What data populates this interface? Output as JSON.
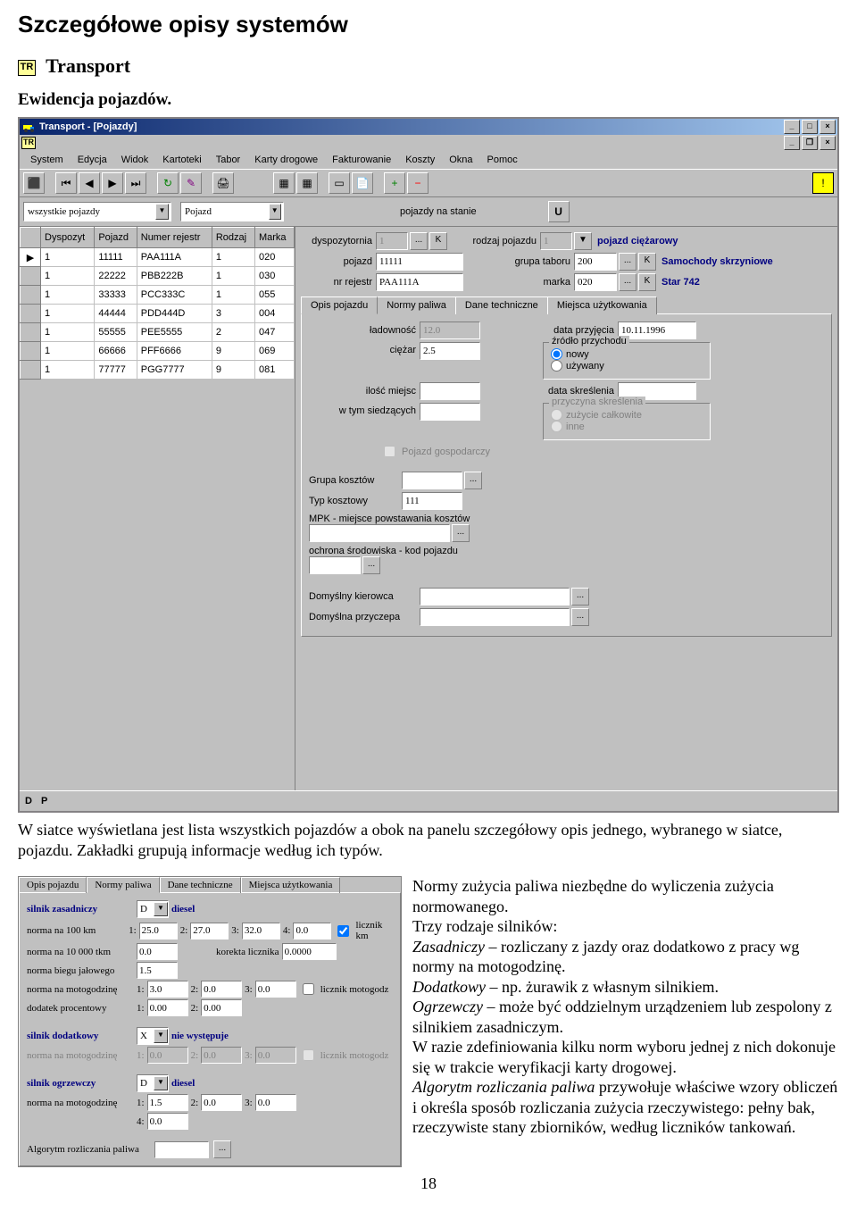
{
  "page": {
    "heading": "Szczegółowe opisy systemów",
    "tr_badge": "TR",
    "subheading": "Transport",
    "section": "Ewidencja pojazdów.",
    "page_number": "18"
  },
  "app": {
    "title": "Transport - [Pojazdy]",
    "menu": [
      "System",
      "Edycja",
      "Widok",
      "Kartoteki",
      "Tabor",
      "Karty drogowe",
      "Fakturowanie",
      "Koszty",
      "Okna",
      "Pomoc"
    ],
    "filter1": "wszystkie pojazdy",
    "filter2": "Pojazd",
    "filter3": "pojazdy na stanie",
    "filter3_btn": "U",
    "grid": {
      "headers": [
        "Dyspozyt",
        "Pojazd",
        "Numer rejestr",
        "Rodzaj",
        "Marka"
      ],
      "rows": [
        [
          "1",
          "11111",
          "PAA111A",
          "1",
          "020"
        ],
        [
          "1",
          "22222",
          "PBB222B",
          "1",
          "030"
        ],
        [
          "1",
          "33333",
          "PCC333C",
          "1",
          "055"
        ],
        [
          "1",
          "44444",
          "PDD444D",
          "3",
          "004"
        ],
        [
          "1",
          "55555",
          "PEE5555",
          "2",
          "047"
        ],
        [
          "1",
          "66666",
          "PFF6666",
          "9",
          "069"
        ],
        [
          "1",
          "77777",
          "PGG7777",
          "9",
          "081"
        ]
      ]
    },
    "form": {
      "dyspozytornia_lbl": "dyspozytornia",
      "dyspozytornia": "1",
      "rodzaj_pojazdu_lbl": "rodzaj pojazdu",
      "rodzaj_pojazdu": "1",
      "rodzaj_pojazdu_desc": "pojazd ciężarowy",
      "pojazd_lbl": "pojazd",
      "pojazd": "11111",
      "grupa_taboru_lbl": "grupa taboru",
      "grupa_taboru": "200",
      "grupa_taboru_desc": "Samochody skrzyniowe",
      "nr_rejestr_lbl": "nr rejestr",
      "nr_rejestr": "PAA111A",
      "marka_lbl": "marka",
      "marka": "020",
      "marka_desc": "Star 742",
      "tabs": [
        "Opis pojazdu",
        "Normy paliwa",
        "Dane techniczne",
        "Miejsca użytkowania"
      ],
      "ladownosc_lbl": "ładowność",
      "ladownosc": "12.0",
      "data_przyjecia_lbl": "data przyjęcia",
      "data_przyjecia": "10.11.1996",
      "ciezar_lbl": "ciężar",
      "ciezar": "2.5",
      "zrodlo_legend": "źródło przychodu",
      "zrodlo_nowy": "nowy",
      "zrodlo_uzywany": "używany",
      "ilosc_miejsc_lbl": "ilość miejsc",
      "data_skreslenia_lbl": "data skreślenia",
      "siedzacych_lbl": "w tym siedzących",
      "przyczyna_legend": "przyczyna skreślenia",
      "przyczyna_zuzycie": "zużycie całkowite",
      "przyczyna_inne": "inne",
      "gospodarczy_lbl": "Pojazd gospodarczy",
      "grupa_kosztow_lbl": "Grupa kosztów",
      "typ_kosztowy_lbl": "Typ kosztowy",
      "typ_kosztowy": "111",
      "mpk_lbl": "MPK - miejsce powstawania kosztów",
      "ochrona_lbl": "ochrona środowiska - kod pojazdu",
      "kierowca_lbl": "Domyślny kierowca",
      "przyczepa_lbl": "Domyślna przyczepa"
    },
    "status": {
      "d": "D",
      "p": "P"
    }
  },
  "description": {
    "p1": "W siatce wyświetlana jest lista wszystkich pojazdów a obok na panelu szczegółowy opis jednego, wybranego w siatce, pojazdu. Zakładki grupują informacje według ich typów.",
    "p2a": "Normy zużycia paliwa niezbędne do wyliczenia zużycia normowanego.",
    "p2b": "Trzy rodzaje silników:",
    "p2c_i": "Zasadniczy",
    "p2c": " – rozliczany z jazdy oraz dodatkowo z pracy wg normy na motogodzinę.",
    "p2d_i": "Dodatkowy",
    "p2d": " – np. żurawik z własnym silnikiem.",
    "p2e_i": "Ogrzewczy",
    "p2e": " – może być oddzielnym urządzeniem lub zespolony z silnikiem zasadniczym.",
    "p2f": "W razie zdefiniowania kilku norm wyboru jednej z nich dokonuje się w trakcie weryfikacji karty drogowej.",
    "p2g_i": "Algorytm rozliczania paliwa",
    "p2g": " przywołuje właściwe wzory obliczeń i określa sposób rozliczania zużycia rzeczywistego: pełny bak, rzeczywiste stany zbiorników, według liczników tankowań."
  },
  "norms": {
    "tabs": [
      "Opis pojazdu",
      "Normy paliwa",
      "Dane techniczne",
      "Miejsca użytkowania"
    ],
    "s1_label": "silnik zasadniczy",
    "s1_type": "D",
    "s1_desc": "diesel",
    "n100_lbl": "norma na 100 km",
    "n100": [
      "25.0",
      "27.0",
      "32.0",
      "0.0"
    ],
    "licznik_km": "licznik km",
    "n10000_lbl": "norma na 10 000 tkm",
    "n10000": "0.0",
    "korekta_lbl": "korekta licznika",
    "korekta": "0.0000",
    "bieg_lbl": "norma biegu jałowego",
    "bieg": "1.5",
    "motog_lbl": "norma na motogodzinę",
    "motog": [
      "3.0",
      "0.0",
      "0.0"
    ],
    "licznik_motog": "licznik motogodz",
    "proc_lbl": "dodatek procentowy",
    "proc": [
      "0.00",
      "0.00"
    ],
    "s2_label": "silnik dodatkowy",
    "s2_type": "X",
    "s2_desc": "nie występuje",
    "s2_motog_lbl": "norma na motogodzinę",
    "s2_motog": [
      "0.0",
      "0.0",
      "0.0"
    ],
    "s2_licznik": "licznik motogodz",
    "s3_label": "silnik ogrzewczy",
    "s3_type": "D",
    "s3_desc": "diesel",
    "s3_motog_lbl": "norma na motogodzinę",
    "s3_motog": [
      "1.5",
      "0.0",
      "0.0"
    ],
    "s3_4": "0.0",
    "alg_lbl": "Algorytm rozliczania paliwa"
  }
}
